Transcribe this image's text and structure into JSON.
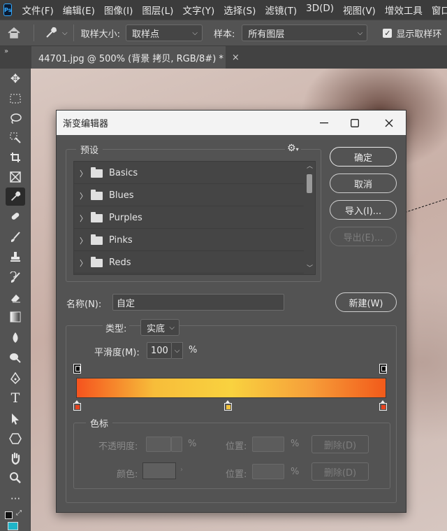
{
  "app": {
    "logo_text": "Ps"
  },
  "menubar": {
    "items": [
      "文件(F)",
      "编辑(E)",
      "图像(I)",
      "图层(L)",
      "文字(Y)",
      "选择(S)",
      "滤镜(T)",
      "3D(D)",
      "视图(V)",
      "增效工具",
      "窗口(W)"
    ]
  },
  "options_bar": {
    "sample_size_label": "取样大小:",
    "sample_size_value": "取样点",
    "sample_label": "样本:",
    "sample_value": "所有图层",
    "show_ring_label": "显示取样环",
    "show_ring_checked": true
  },
  "document_tab": {
    "title": "44701.jpg @ 500% (背景 拷贝, RGB/8#) *",
    "close": "×"
  },
  "toolbar": {
    "tools": [
      "move-tool",
      "marquee-tool",
      "lasso-tool",
      "quick-select-tool",
      "crop-tool",
      "frame-tool",
      "eyedropper-tool",
      "healing-tool",
      "brush-tool",
      "stamp-tool",
      "history-brush-tool",
      "eraser-tool",
      "gradient-tool",
      "blur-tool",
      "dodge-tool",
      "pen-tool",
      "type-tool",
      "path-select-tool",
      "shape-tool",
      "hand-tool",
      "zoom-tool",
      "more-tools"
    ],
    "active_tool": "eyedropper-tool"
  },
  "dialog": {
    "title": "渐变编辑器",
    "presets_label": "预设",
    "presets": [
      "Basics",
      "Blues",
      "Purples",
      "Pinks",
      "Reds"
    ],
    "buttons": {
      "ok": "确定",
      "cancel": "取消",
      "import": "导入(I)...",
      "export": "导出(E)...",
      "new": "新建(W)"
    },
    "name_label": "名称(N):",
    "name_value": "自定",
    "type_label": "类型:",
    "type_value": "实底",
    "smoothness_label": "平滑度(M):",
    "smoothness_value": "100",
    "smoothness_unit": "%",
    "gradient": {
      "colors": [
        "#f5531e",
        "#f7bd3a",
        "#f9d23f",
        "#f6a03a",
        "#f25a1a"
      ],
      "color_stops": [
        "#e8421d",
        "#f2c23a",
        "#e8421d"
      ]
    },
    "stops_group_label": "色标",
    "opacity_label": "不透明度:",
    "opacity_unit": "%",
    "position_label_1": "位置:",
    "position_unit_1": "%",
    "delete_label_1": "删除(D)",
    "color_label": "颜色:",
    "position_label_2": "位置:",
    "position_unit_2": "%",
    "delete_label_2": "删除(D)"
  }
}
